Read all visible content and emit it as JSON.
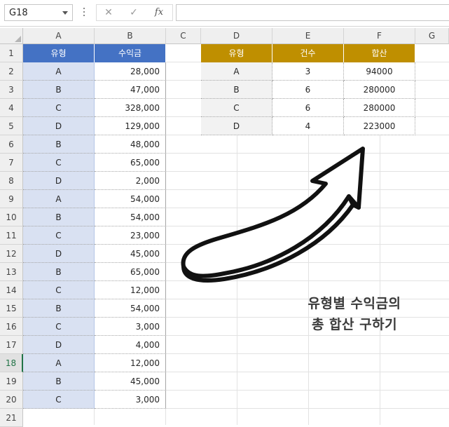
{
  "formula_bar": {
    "name_box": "G18",
    "cancel_glyph": "✕",
    "enter_glyph": "✓",
    "fx_label": "fx",
    "formula": ""
  },
  "columns": [
    "A",
    "B",
    "C",
    "D",
    "E",
    "F",
    "G"
  ],
  "rows": [
    "1",
    "2",
    "3",
    "4",
    "5",
    "6",
    "7",
    "8",
    "9",
    "10",
    "11",
    "12",
    "13",
    "14",
    "15",
    "16",
    "17",
    "18",
    "19",
    "20",
    "21"
  ],
  "selected_row": "18",
  "left_table": {
    "headers": [
      "유형",
      "수익금"
    ],
    "rows": [
      [
        "A",
        "28,000"
      ],
      [
        "B",
        "47,000"
      ],
      [
        "C",
        "328,000"
      ],
      [
        "D",
        "129,000"
      ],
      [
        "B",
        "48,000"
      ],
      [
        "C",
        "65,000"
      ],
      [
        "D",
        "2,000"
      ],
      [
        "A",
        "54,000"
      ],
      [
        "B",
        "54,000"
      ],
      [
        "C",
        "23,000"
      ],
      [
        "D",
        "45,000"
      ],
      [
        "B",
        "65,000"
      ],
      [
        "C",
        "12,000"
      ],
      [
        "B",
        "54,000"
      ],
      [
        "C",
        "3,000"
      ],
      [
        "D",
        "4,000"
      ],
      [
        "A",
        "12,000"
      ],
      [
        "B",
        "45,000"
      ],
      [
        "C",
        "3,000"
      ]
    ]
  },
  "summary_table": {
    "headers": [
      "유형",
      "건수",
      "합산"
    ],
    "rows": [
      [
        "A",
        "3",
        "94000"
      ],
      [
        "B",
        "6",
        "280000"
      ],
      [
        "C",
        "6",
        "280000"
      ],
      [
        "D",
        "4",
        "223000"
      ]
    ]
  },
  "caption": {
    "line1": "유형별 수익금의",
    "line2": "총 합산 구하기"
  },
  "colors": {
    "left_header": "#4472c4",
    "summary_header": "#bf8f00",
    "type_column_fill": "#d9e1f2",
    "selection_accent": "#217346"
  },
  "icons": {
    "arrow": "curved-arrow-icon"
  }
}
